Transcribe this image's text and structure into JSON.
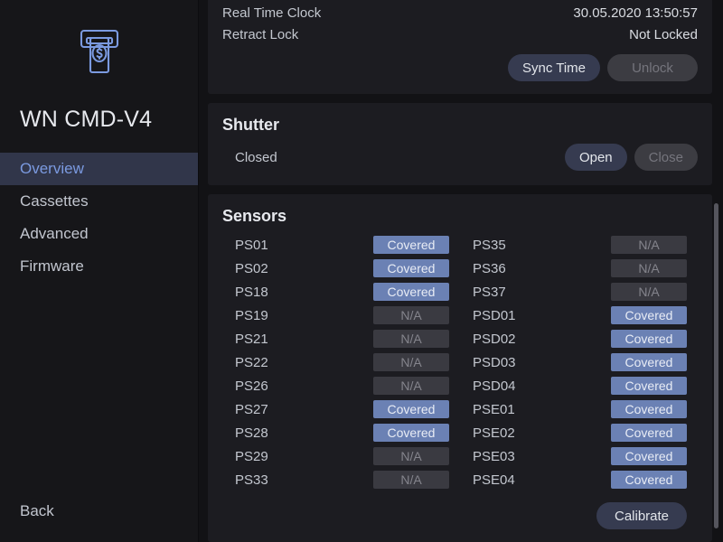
{
  "sidebar": {
    "logo_icon": "cash-dispenser-icon",
    "title": "WN CMD-V4",
    "items": [
      {
        "label": "Overview",
        "active": true
      },
      {
        "label": "Cassettes",
        "active": false
      },
      {
        "label": "Advanced",
        "active": false
      },
      {
        "label": "Firmware",
        "active": false
      }
    ],
    "back_label": "Back"
  },
  "status_panel": {
    "clipped_row": {
      "label": "",
      "value": ""
    },
    "rows": [
      {
        "label": "Real Time Clock",
        "value": "30.05.2020 13:50:57"
      },
      {
        "label": "Retract Lock",
        "value": "Not Locked"
      }
    ],
    "sync_time_label": "Sync Time",
    "unlock_label": "Unlock"
  },
  "shutter_panel": {
    "title": "Shutter",
    "state": "Closed",
    "open_label": "Open",
    "close_label": "Close"
  },
  "sensors_panel": {
    "title": "Sensors",
    "calibrate_label": "Calibrate",
    "left_column": [
      {
        "name": "PS01",
        "status": "Covered"
      },
      {
        "name": "PS02",
        "status": "Covered"
      },
      {
        "name": "PS18",
        "status": "Covered"
      },
      {
        "name": "PS19",
        "status": "N/A"
      },
      {
        "name": "PS21",
        "status": "N/A"
      },
      {
        "name": "PS22",
        "status": "N/A"
      },
      {
        "name": "PS26",
        "status": "N/A"
      },
      {
        "name": "PS27",
        "status": "Covered"
      },
      {
        "name": "PS28",
        "status": "Covered"
      },
      {
        "name": "PS29",
        "status": "N/A"
      },
      {
        "name": "PS33",
        "status": "N/A"
      }
    ],
    "right_column": [
      {
        "name": "PS35",
        "status": "N/A"
      },
      {
        "name": "PS36",
        "status": "N/A"
      },
      {
        "name": "PS37",
        "status": "N/A"
      },
      {
        "name": "PSD01",
        "status": "Covered"
      },
      {
        "name": "PSD02",
        "status": "Covered"
      },
      {
        "name": "PSD03",
        "status": "Covered"
      },
      {
        "name": "PSD04",
        "status": "Covered"
      },
      {
        "name": "PSE01",
        "status": "Covered"
      },
      {
        "name": "PSE02",
        "status": "Covered"
      },
      {
        "name": "PSE03",
        "status": "Covered"
      },
      {
        "name": "PSE04",
        "status": "Covered"
      }
    ]
  },
  "colors": {
    "accent_blue": "#7b9ae0",
    "badge_covered": "#6b81b4",
    "badge_na": "#3a3a41",
    "panel_bg": "#1c1c21",
    "sidebar_bg": "#161619",
    "active_nav_bg": "#31364a",
    "button_primary": "#363b50",
    "button_disabled": "#3c3c42"
  }
}
